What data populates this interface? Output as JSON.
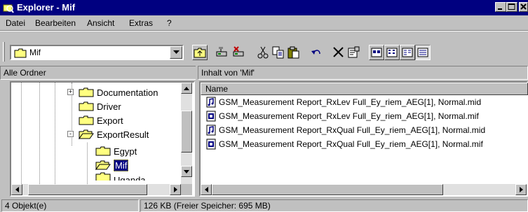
{
  "window": {
    "title": "Explorer - Mif"
  },
  "menu": [
    {
      "label": "Datei"
    },
    {
      "label": "Bearbeiten"
    },
    {
      "label": "Ansicht"
    },
    {
      "label": "Extras"
    },
    {
      "label": "?"
    }
  ],
  "toolbar": {
    "address_value": "Mif",
    "buttons": [
      "up-one-level",
      "map-drive",
      "disconnect-drive",
      "cut",
      "copy",
      "paste",
      "undo",
      "delete",
      "properties",
      "large-icons",
      "small-icons",
      "list",
      "details"
    ]
  },
  "tree": {
    "header": "Alle Ordner",
    "items": [
      {
        "label": "Documentation",
        "expander": "+"
      },
      {
        "label": "Driver"
      },
      {
        "label": "Export"
      },
      {
        "label": "ExportResult",
        "expander": "-"
      },
      {
        "label": "Egypt"
      },
      {
        "label": "Mif",
        "selected": true
      },
      {
        "label": "Uganda"
      }
    ]
  },
  "contents": {
    "header": "Inhalt von 'Mif'",
    "column_name": "Name",
    "files": [
      {
        "name": "GSM_Measurement Report_RxLev Full_Ey_riem_AEG[1], Normal.mid",
        "icon": "mid-file-icon"
      },
      {
        "name": "GSM_Measurement Report_RxLev Full_Ey_riem_AEG[1], Normal.mif",
        "icon": "mif-file-icon"
      },
      {
        "name": "GSM_Measurement Report_RxQual Full_Ey_riem_AEG[1], Normal.mid",
        "icon": "mid-file-icon"
      },
      {
        "name": "GSM_Measurement Report_RxQual Full_Ey_riem_AEG[1], Normal.mif",
        "icon": "mif-file-icon"
      }
    ]
  },
  "status": {
    "objects": "4 Objekt(e)",
    "size": "126 KB (Freier Speicher: 695 MB)"
  },
  "colors": {
    "titlebar": "#000080",
    "face": "#c0c0c0",
    "selection": "#000080",
    "folder": "#ffff80"
  }
}
